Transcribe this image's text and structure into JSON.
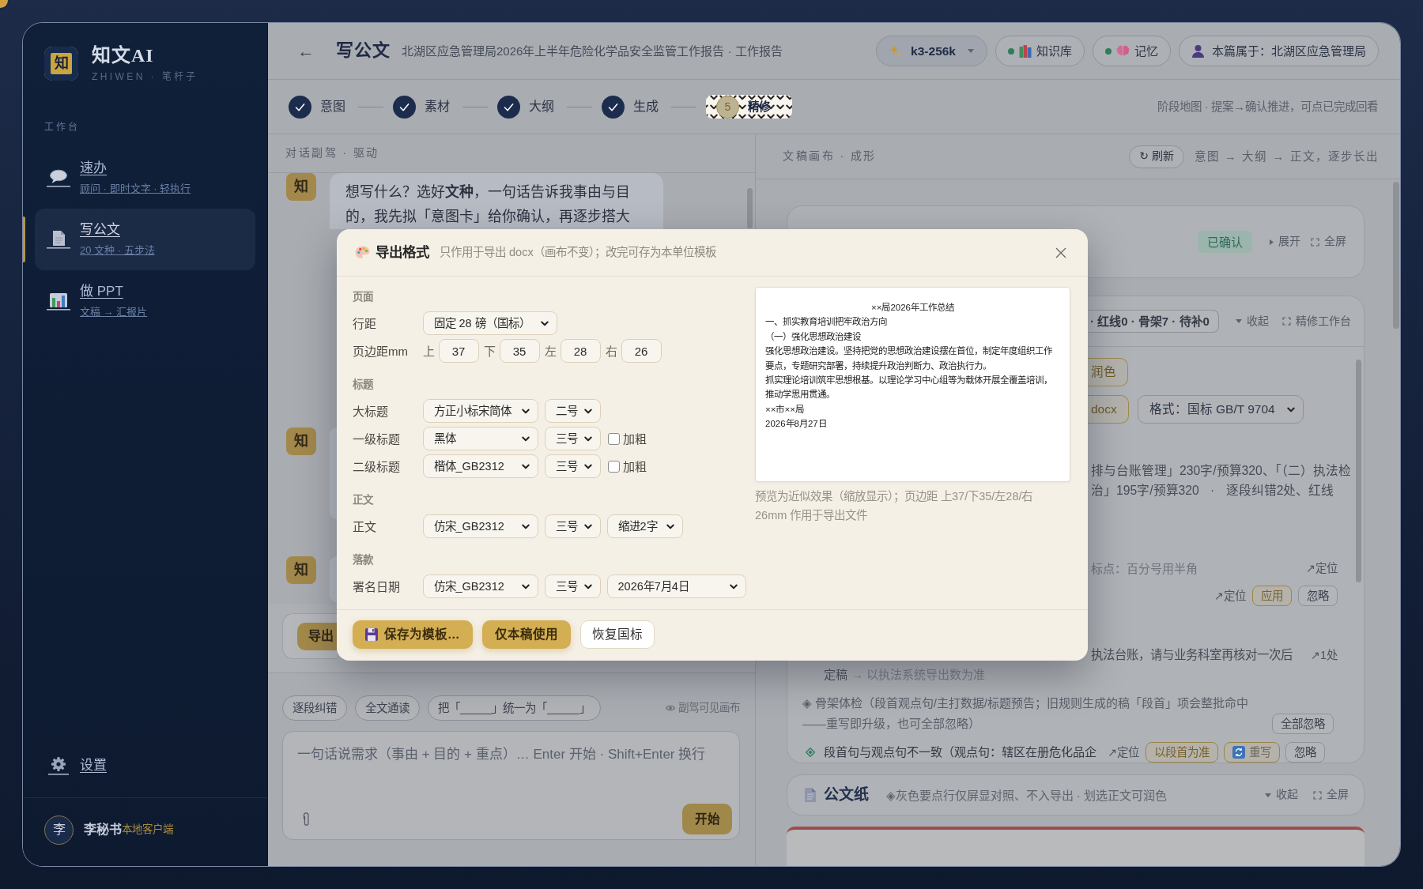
{
  "sidebar": {
    "logo": {
      "mark": "知",
      "title": "知文AI",
      "subtitle": "ZHIWEN · 笔杆子"
    },
    "section": "工作台",
    "items": [
      {
        "kind": "chat",
        "title": "速办",
        "subtitle": "顾问 · 即时文字 · 轻执行",
        "selected": false
      },
      {
        "kind": "document",
        "title": "写公文",
        "subtitle": "20 文种 · 五步法",
        "selected": true
      },
      {
        "kind": "chart",
        "title": "做 PPT",
        "subtitle": "文稿 → 汇报片",
        "selected": false
      }
    ],
    "settings": "设置",
    "user": {
      "avatar": "李",
      "name": "李秘书",
      "client": "本地客户端"
    }
  },
  "header": {
    "back": "←",
    "title": "写公文",
    "breadcrumb": "北湖区应急管理局2026年上半年危险化学品安全监管工作报告 · 工作报告",
    "model": "k3-256k",
    "toggles": [
      {
        "kind": "knowledge",
        "label": "知识库",
        "on": true
      },
      {
        "kind": "memory",
        "label": "记忆",
        "on": true
      }
    ],
    "owner": "本篇属于：北湖区应急管理局"
  },
  "stepper": {
    "steps": [
      {
        "label": "意图",
        "done": true,
        "selected": false
      },
      {
        "label": "素材",
        "done": true,
        "selected": false
      },
      {
        "label": "大纲",
        "done": true,
        "selected": false
      },
      {
        "label": "生成",
        "done": true,
        "selected": false
      },
      {
        "label": "精修",
        "number": "5",
        "done": false,
        "selected": true
      }
    ],
    "hint": "阶段地图 · 提案→确认推进，可点已完成回看"
  },
  "chat": {
    "title": "对话副驾 · 驱动",
    "messages": [
      {
        "avatar": "知",
        "text": "想写什么？选好**文种**，一句话告诉我事由与目的，我先拟「意图卡」给你确认，再逐步搭大"
      },
      {
        "avatar": "知"
      },
      {
        "avatar": "知"
      }
    ],
    "toolbar_button": "导出",
    "chips": [
      "逐段纠错",
      "全文通读",
      "把「_____」统一为「_____」"
    ],
    "visibility": "副驾可见画布",
    "input": {
      "placeholder": "一句话说需求（事由 + 目的 + 重点）… Enter 开始 · Shift+Enter 换行"
    },
    "send": "开始"
  },
  "canvas": {
    "title": "文稿画布 · 成形",
    "refresh": "↻ 刷新",
    "flow": "意图 → 大纲 → 正文，逐步长出",
    "intent_card": {
      "status": "已确认",
      "actions": [
        {
          "kind": "expand",
          "label": "展开"
        },
        {
          "kind": "fullscreen",
          "label": "全屏"
        }
      ]
    },
    "refine_card": {
      "summary": "· 红线0 · 骨架7 · 待补0",
      "actions": [
        {
          "kind": "collapse",
          "label": "收起"
        },
        {
          "kind": "fullscreen",
          "label": "精修工作台"
        }
      ],
      "polish_button": "润色",
      "export_button": "docx",
      "format_select": "格式：国标 GB/T 9704",
      "stats": [
        "排与台账管理」230字/预算320、「（二）执法检",
        "治」195字/预算320 · 逐段纠错2处、红线"
      ],
      "rows": [
        {
          "kind": "hint",
          "text": "标点：百分号用半角",
          "link": "↗定位"
        },
        {
          "kind": "actions",
          "link": "↗定位",
          "buttons": [
            {
              "kind": "accent",
              "label": "应用"
            },
            {
              "kind": "plain",
              "label": "忽略"
            }
          ]
        },
        {
          "kind": "note",
          "text": "执法台账，请与业务科室再核对一次后",
          "link": "↗1处"
        },
        {
          "kind": "continuation",
          "text": "定稿",
          "note": "→ 以执法系统导出数为准"
        },
        {
          "kind": "group",
          "text": "◈ 骨架体检（段首观点句/主打数据/标题预告；旧规则生成的稿「段首」项会整批命中——重写即升级，也可全部忽略）",
          "buttons": [
            {
              "kind": "plain",
              "label": "全部忽略"
            }
          ]
        },
        {
          "kind": "issue",
          "text": "段首句与观点句不一致（观点句：辖区在册危化品企",
          "link": "↗定位",
          "buttons": [
            {
              "kind": "accent",
              "label": "以段首为准"
            },
            {
              "kind": "rewrite",
              "label": "重写"
            },
            {
              "kind": "plain",
              "label": "忽略"
            }
          ]
        }
      ]
    },
    "paper_card": {
      "title": "公文纸",
      "note": "◈灰色要点行仅屏显对照、不入导出 · 划选正文可润色",
      "actions": [
        {
          "kind": "collapse",
          "label": "收起"
        },
        {
          "kind": "fullscreen",
          "label": "全屏"
        }
      ]
    }
  },
  "modal": {
    "title": "导出格式",
    "subtitle": "只作用于导出 docx（画布不变）；改完可存为本单位模板",
    "sections": [
      {
        "label": "页面",
        "rows": [
          {
            "label": "行距",
            "fields": [
              {
                "kind": "spacing",
                "value": "固定 28 磅（国标）"
              }
            ]
          },
          {
            "label": "页边距mm",
            "fields": [
              {
                "kind": "number",
                "prefix": "上",
                "value": "37"
              },
              {
                "kind": "number",
                "prefix": "下",
                "value": "35"
              },
              {
                "kind": "number",
                "prefix": "左",
                "value": "28"
              },
              {
                "kind": "number",
                "prefix": "右",
                "value": "26"
              }
            ]
          }
        ]
      },
      {
        "label": "标题",
        "rows": [
          {
            "label": "大标题",
            "fields": [
              {
                "kind": "font",
                "value": "方正小标宋简体"
              },
              {
                "kind": "size",
                "value": "二号"
              }
            ]
          },
          {
            "label": "一级标题",
            "fields": [
              {
                "kind": "font",
                "value": "黑体"
              },
              {
                "kind": "size",
                "value": "三号"
              },
              {
                "kind": "checkbox",
                "label": "加粗",
                "checked": false
              }
            ]
          },
          {
            "label": "二级标题",
            "fields": [
              {
                "kind": "font",
                "value": "楷体_GB2312"
              },
              {
                "kind": "size",
                "value": "三号"
              },
              {
                "kind": "checkbox",
                "label": "加粗",
                "checked": false
              }
            ]
          }
        ]
      },
      {
        "label": "正文",
        "rows": [
          {
            "label": "正文",
            "fields": [
              {
                "kind": "font",
                "value": "仿宋_GB2312"
              },
              {
                "kind": "size",
                "value": "三号"
              },
              {
                "kind": "indent",
                "value": "缩进2字"
              }
            ]
          }
        ]
      },
      {
        "label": "落款",
        "rows": [
          {
            "label": "署名日期",
            "fields": [
              {
                "kind": "font",
                "value": "仿宋_GB2312"
              },
              {
                "kind": "size",
                "value": "三号"
              },
              {
                "kind": "date",
                "value": "2026年7月4日"
              }
            ]
          }
        ]
      }
    ],
    "preview": [
      {
        "kind": "title",
        "text": "××局2026年工作总结"
      },
      {
        "kind": "heading",
        "text": "一、抓实教育培训把牢政治方向"
      },
      {
        "kind": "subheading",
        "text": "（一）强化思想政治建设"
      },
      {
        "kind": "body",
        "text": "强化思想政治建设。坚持把党的思想政治建设摆在首位，制定年度组织工作要点，专题研究部署，持续提升政治判断力、政治执行力。"
      },
      {
        "kind": "body",
        "text": "抓实理论培训筑牢思想根基。以理论学习中心组等为载体开展全覆盖培训，推动学思用贯通。"
      },
      {
        "kind": "signature",
        "text": "××市××局"
      },
      {
        "kind": "signature",
        "text": "2026年8月27日"
      }
    ],
    "caption": "预览为近似效果（缩放显示）；页边距 上37/下35/左28/右26mm 作用于导出文件",
    "buttons": [
      {
        "kind": "save",
        "label": "保存为模板…"
      },
      {
        "kind": "primary",
        "label": "仅本稿使用"
      },
      {
        "kind": "outline",
        "label": "恢复国标"
      }
    ]
  }
}
